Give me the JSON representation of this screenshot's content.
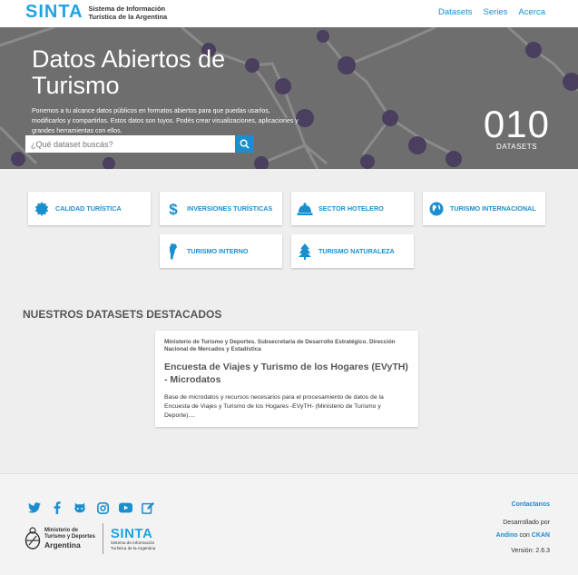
{
  "header": {
    "logo_word": "SINTA",
    "logo_sub_line1": "Sistema de Información",
    "logo_sub_line2": "Turística de la Argentina",
    "nav": [
      "Datasets",
      "Series",
      "Acerca"
    ]
  },
  "hero": {
    "title": "Datos Abiertos de Turismo",
    "description": "Ponemos a tu alcance datos públicos en formatos abiertos para que puedas usarlos, modificarlos y compartirlos. Estos datos son tuyos. Podés crear visualizaciones, aplicaciones y grandes herramientas con ellos.",
    "search_placeholder": "¿Qué dataset buscás?",
    "counter_value": "010",
    "counter_label": "DATASETS"
  },
  "categories": [
    {
      "label": "CALIDAD TURÍSTICA",
      "icon": "badge-icon"
    },
    {
      "label": "INVERSIONES TURÍSTICAS",
      "icon": "dollar-icon"
    },
    {
      "label": "SECTOR HOTELERO",
      "icon": "bell-icon"
    },
    {
      "label": "TURISMO INTERNACIONAL",
      "icon": "globe-icon"
    },
    {
      "label": "TURISMO INTERNO",
      "icon": "argentina-map-icon"
    },
    {
      "label": "TURISMO NATURALEZA",
      "icon": "tree-icon"
    }
  ],
  "featured": {
    "section_title": "NUESTROS DATASETS DESTACADOS",
    "card": {
      "org": "Ministerio de Turismo y Deportes. Subsecretaría de Desarrollo Estratégico. Dirección Nacional de Mercados y Estadística",
      "title": "Encuesta de Viajes y Turismo de los Hogares (EVyTH) - Microdatos",
      "description": "Base de microdatos y recursos necesarios para el procesamiento de datos de la Encuesta de Viajes y Turismo de los Hogares -EVyTH- (Ministerio de Turismo y Deporte)...."
    }
  },
  "footer": {
    "social_icons": [
      "twitter-icon",
      "facebook-icon",
      "github-icon",
      "instagram-icon",
      "youtube-icon",
      "edit-icon"
    ],
    "ministry_line1": "Ministerio de",
    "ministry_line2": "Turismo y Deportes",
    "ministry_line3": "Argentina",
    "sinta_word": "SINTA",
    "sinta_sub1": "Sistema de Información",
    "sinta_sub2": "Turística de la Argentina",
    "contact": "Contactanos",
    "developed_by": "Desarrollado por",
    "andino": "Andino",
    "with": "con",
    "ckan": "CKAN",
    "version": "Versión: 2.6.3"
  },
  "colors": {
    "accent": "#1a8fd0",
    "brand": "#1ea4e4",
    "hero_bg": "#6e6e6e",
    "node": "#4a3f5e"
  }
}
